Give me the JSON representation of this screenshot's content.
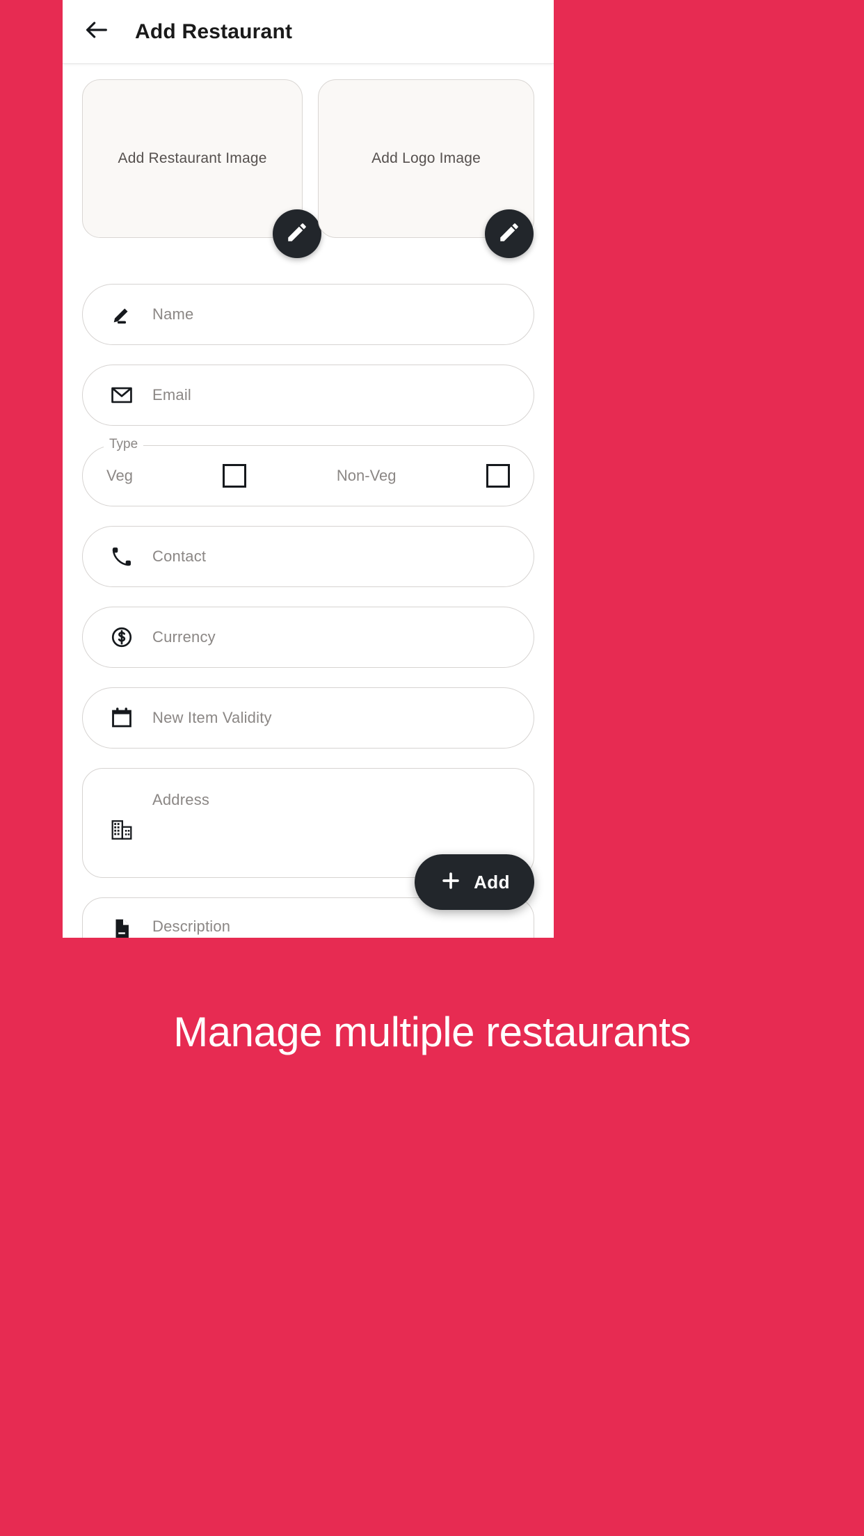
{
  "theme": {
    "background_color": "#E72B52",
    "screen_color": "#FFFFFF",
    "accent_dark": "#22262B",
    "card_fill": "#FAF8F6",
    "border_color": "#D6D3D1",
    "placeholder_color": "#8B8785"
  },
  "appbar": {
    "back_icon": "arrow-left-icon",
    "title": "Add Restaurant"
  },
  "uploads": [
    {
      "label": "Add Restaurant Image",
      "edit_icon": "pencil-icon"
    },
    {
      "label": "Add Logo Image",
      "edit_icon": "pencil-icon"
    }
  ],
  "form": {
    "fields": [
      {
        "id": "name",
        "placeholder": "Name",
        "icon": "pencil-edit-icon"
      },
      {
        "id": "email",
        "placeholder": "Email",
        "icon": "envelope-icon"
      },
      {
        "id": "contact",
        "placeholder": "Contact",
        "icon": "phone-icon"
      },
      {
        "id": "currency",
        "placeholder": "Currency",
        "icon": "dollar-circle-icon"
      },
      {
        "id": "validity",
        "placeholder": "New Item Validity",
        "icon": "calendar-icon"
      },
      {
        "id": "address",
        "placeholder": "Address",
        "icon": "building-icon"
      },
      {
        "id": "description",
        "placeholder": "Description",
        "icon": "document-icon"
      }
    ],
    "type_group": {
      "legend": "Type",
      "options": [
        {
          "label": "Veg",
          "checked": false
        },
        {
          "label": "Non-Veg",
          "checked": false
        }
      ]
    }
  },
  "add_button": {
    "label": "Add",
    "icon": "plus-icon"
  },
  "caption": {
    "text": "Manage multiple restaurants"
  }
}
